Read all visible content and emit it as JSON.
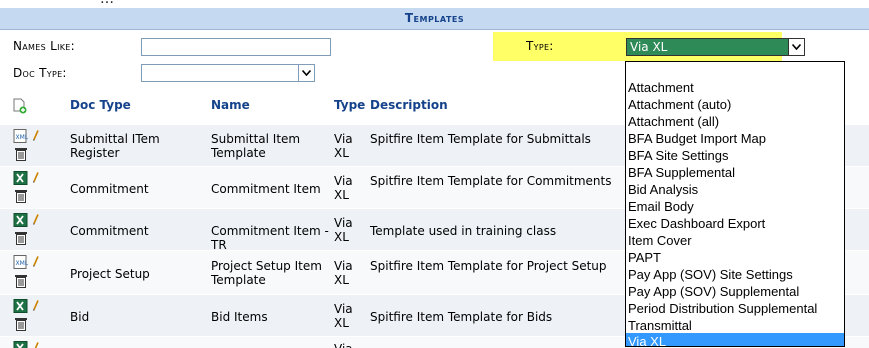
{
  "title": "Templates",
  "filters": {
    "names_like_label": "Names Like:",
    "names_like_value": "",
    "doc_type_label": "Doc Type:",
    "doc_type_value": "",
    "type_label": "Type:",
    "type_value": "Via XL"
  },
  "grid": {
    "headers": {
      "doc_type": "Doc Type",
      "name": "Name",
      "type": "Type",
      "description": "Description"
    },
    "rows": [
      {
        "icon": "xml-file-icon",
        "doc_type": "Submittal ITem Register",
        "name": "Submittal Item Template",
        "type": "Via XL",
        "description": "Spitfire Item Template for Submittals"
      },
      {
        "icon": "excel-file-icon",
        "doc_type": "Commitment",
        "name": "Commitment Item",
        "type": "Via XL",
        "description": "Spitfire Item Template for Commitments"
      },
      {
        "icon": "excel-file-icon",
        "doc_type": "Commitment",
        "name": "Commitment Item - TR",
        "type": "Via XL",
        "description": "Template used in training class"
      },
      {
        "icon": "xml-file-icon",
        "doc_type": "Project Setup",
        "name": "Project Setup Item Template",
        "type": "Via XL",
        "description": "Spitfire Item Template for Project Setup"
      },
      {
        "icon": "excel-file-icon",
        "doc_type": "Bid",
        "name": "Bid Items",
        "type": "Via XL",
        "description": "Spitfire Item Template for Bids"
      },
      {
        "icon": "excel-file-icon",
        "doc_type": "",
        "name": "",
        "type": "Via",
        "description": ""
      }
    ]
  },
  "type_dropdown": {
    "options": [
      "",
      "Attachment",
      "Attachment (auto)",
      "Attachment (all)",
      "BFA Budget Import Map",
      "BFA Site Settings",
      "BFA Supplemental",
      "Bid Analysis",
      "Email Body",
      "Exec Dashboard Export",
      "Item Cover",
      "PAPT",
      "Pay App (SOV) Site Settings",
      "Pay App (SOV) Supplemental",
      "Period Distribution Supplemental",
      "Transmittal",
      "Via XL"
    ],
    "selected": "Via XL"
  },
  "colors": {
    "header_bg": "#c5d9f1",
    "header_text": "#15428b",
    "type_highlight": "#ffff66",
    "type_select_bg": "#2e8b57",
    "dropdown_selected": "#3399ff"
  }
}
